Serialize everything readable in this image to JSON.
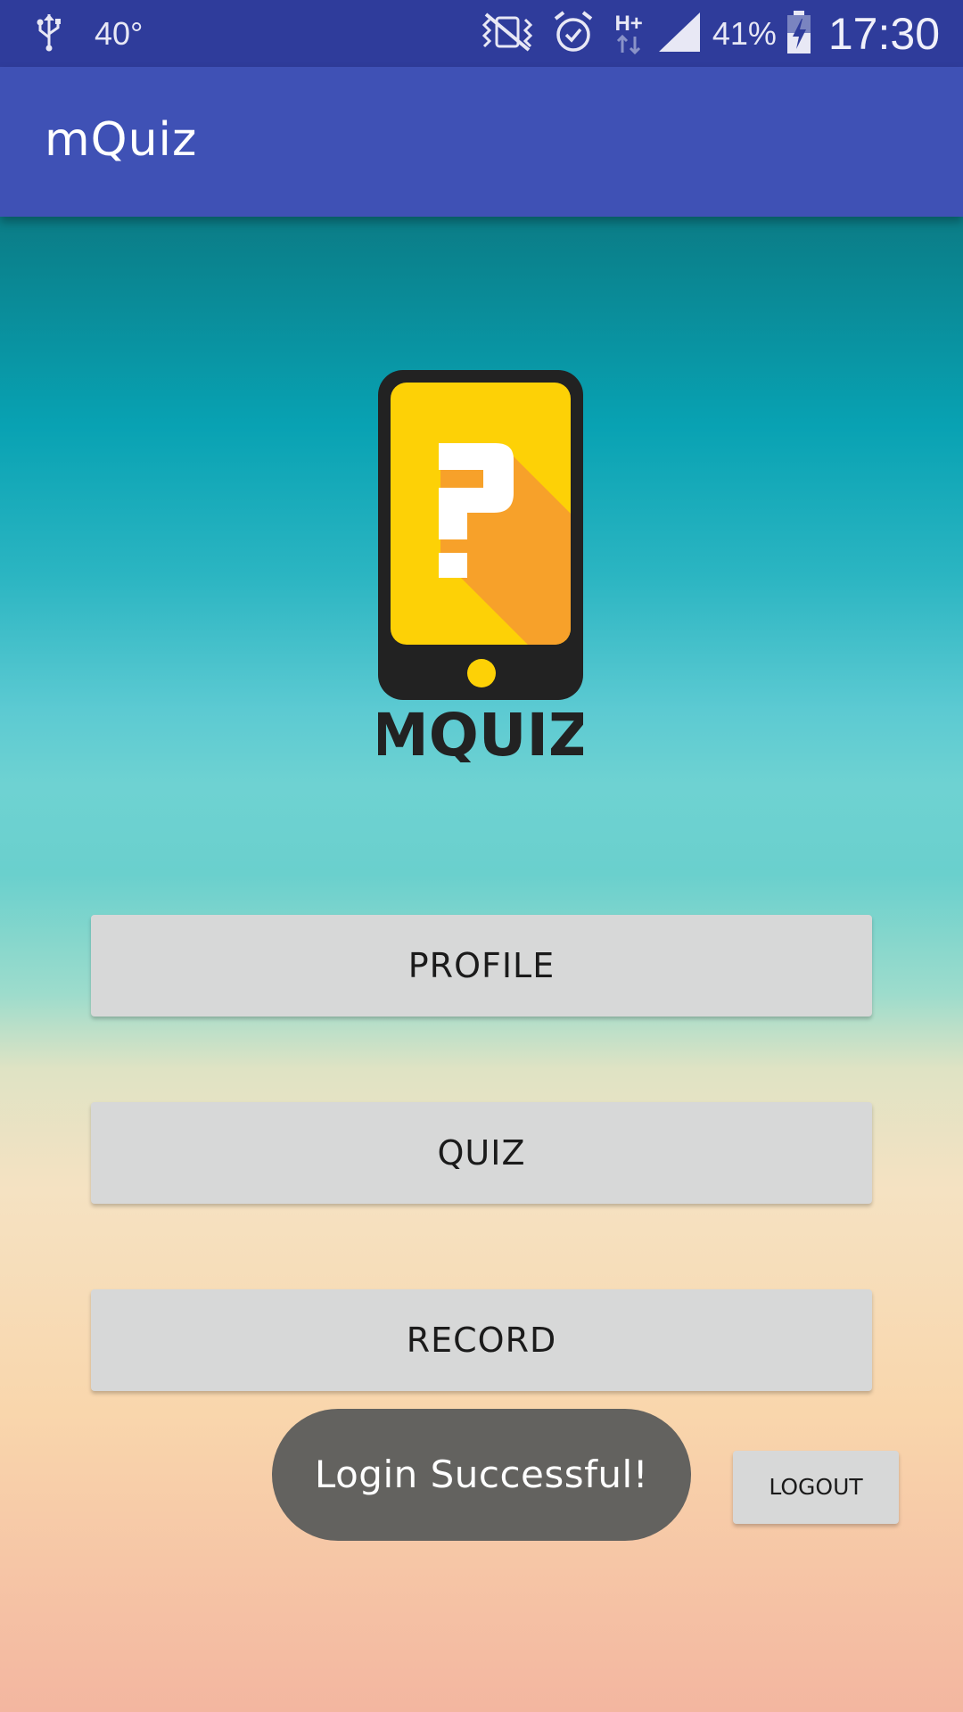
{
  "status_bar": {
    "temperature": "40°",
    "network_type": "H+",
    "battery_percent": "41%",
    "time": "17:30",
    "icons": [
      "usb-icon",
      "vibrate-icon",
      "alarm-icon",
      "data-arrows-icon",
      "signal-icon",
      "battery-charging-icon"
    ]
  },
  "app_bar": {
    "title": "mQuiz"
  },
  "logo": {
    "wordmark": "MQUIZ",
    "symbol": "?"
  },
  "buttons": {
    "profile": "PROFILE",
    "quiz": "QUIZ",
    "record": "RECORD",
    "logout": "LOGOUT"
  },
  "toast": {
    "message": "Login Successful!"
  },
  "colors": {
    "status_bar": "#2f3c9b",
    "app_bar": "#3f51b5",
    "button_bg": "#d7d8d8",
    "toast_bg": "#63625f",
    "logo_yellow": "#fdd106",
    "logo_orange": "#f7a12a",
    "logo_dark": "#222222"
  }
}
